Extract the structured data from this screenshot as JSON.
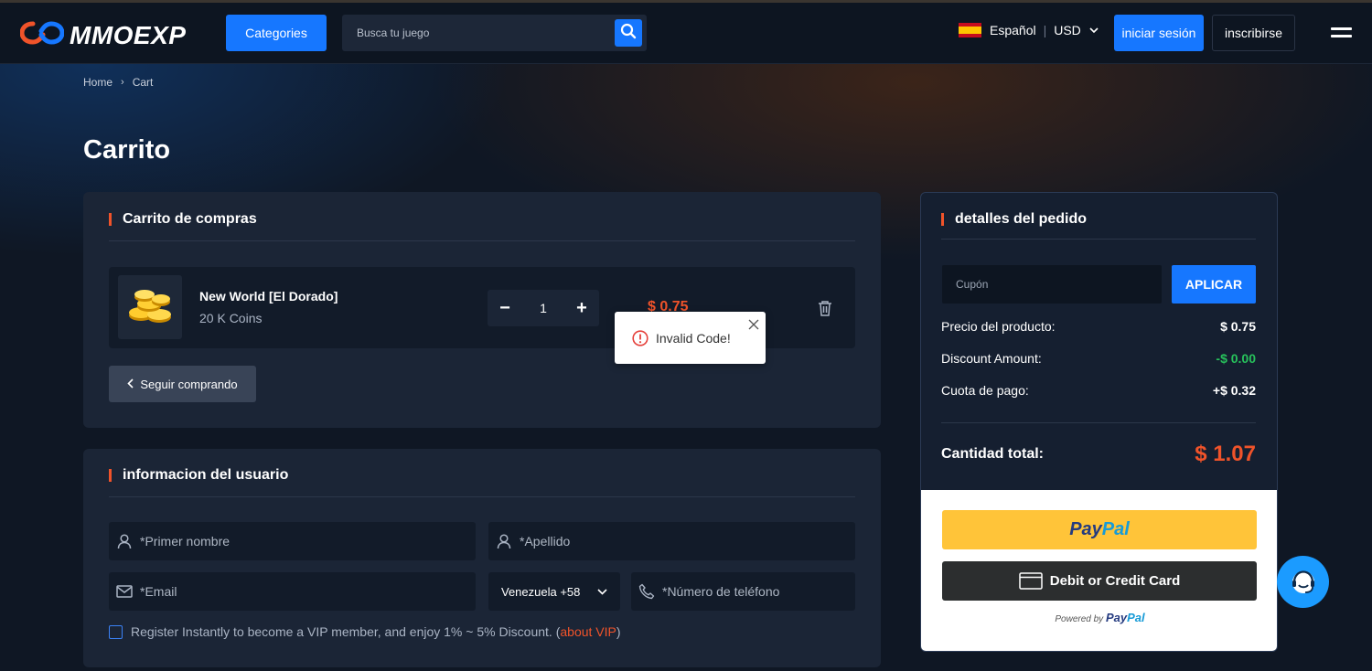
{
  "header": {
    "logo_text": "MMOEXP",
    "categories_label": "Categories",
    "search_placeholder": "Busca tu juego",
    "language": "Español",
    "currency": "USD",
    "login_label": "iniciar sesión",
    "signup_label": "inscribirse"
  },
  "breadcrumb": {
    "home": "Home",
    "current": "Cart"
  },
  "page_title": "Carrito",
  "cart": {
    "title": "Carrito de compras",
    "item": {
      "name": "New World [El Dorado]",
      "sub": "20 K Coins",
      "quantity": "1",
      "price": "$ 0.75",
      "minus": "−",
      "plus": "+"
    },
    "continue_label": "Seguir comprando"
  },
  "toast": {
    "message": "Invalid Code!"
  },
  "user_info": {
    "title": "informacion del usuario",
    "first_name_placeholder": "*Primer nombre",
    "last_name_placeholder": "*Apellido",
    "email_placeholder": "*Email",
    "country": "Venezuela +58",
    "phone_placeholder": "*Número de teléfono",
    "vip_text": "Register Instantly to become a VIP member, and enjoy 1% ~ 5% Discount. (",
    "vip_link": "about VIP",
    "vip_close": ")"
  },
  "order": {
    "title": "detalles del pedido",
    "coupon_placeholder": "Cupón",
    "apply_label": "APLICAR",
    "product_price_label": "Precio del producto:",
    "product_price": "$ 0.75",
    "discount_label": "Discount Amount:",
    "discount": "-$ 0.00",
    "fee_label": "Cuota de pago:",
    "fee": "+$ 0.32",
    "total_label": "Cantidad total:",
    "total": "$ 1.07",
    "paypal_a": "Pay",
    "paypal_b": "Pal",
    "card_label": "Debit or Credit Card",
    "powered_by": "Powered by ",
    "powered_a": "Pay",
    "powered_b": "Pal"
  },
  "colors": {
    "accent": "#1677ff",
    "price": "#f0532a",
    "discount": "#27c15b",
    "paypal_yellow": "#ffc439"
  },
  "icons": [
    "logo-infinity-icon",
    "search-icon",
    "spain-flag-icon",
    "chevron-down-icon",
    "hamburger-menu-icon",
    "coins-icon",
    "trash-icon",
    "error-icon",
    "close-icon",
    "chevron-left-icon",
    "user-icon",
    "mail-icon",
    "phone-icon",
    "card-icon",
    "support-chat-icon"
  ]
}
